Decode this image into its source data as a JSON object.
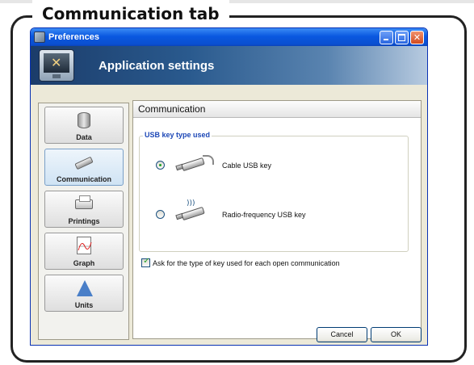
{
  "caption": "Communication tab",
  "window": {
    "title": "Preferences",
    "banner_title": "Application settings"
  },
  "sidebar": {
    "items": [
      {
        "label": "Data",
        "icon": "database-icon",
        "selected": false
      },
      {
        "label": "Communication",
        "icon": "usb-key-icon",
        "selected": true
      },
      {
        "label": "Printings",
        "icon": "printer-icon",
        "selected": false
      },
      {
        "label": "Graph",
        "icon": "graph-icon",
        "selected": false
      },
      {
        "label": "Units",
        "icon": "units-icon",
        "selected": false
      }
    ]
  },
  "panel": {
    "title": "Communication",
    "group_label": "USB key type used",
    "options": [
      {
        "label": "Cable USB key",
        "checked": true
      },
      {
        "label": "Radio-frequency USB key",
        "checked": false
      }
    ],
    "ask_checkbox": {
      "label": "Ask for the type of key used for each open communication",
      "checked": true
    }
  },
  "buttons": {
    "cancel": "Cancel",
    "ok": "OK"
  },
  "colors": {
    "titlebar": "#0a58e0",
    "accent_link": "#1c47b6",
    "check_green": "#21a121"
  }
}
